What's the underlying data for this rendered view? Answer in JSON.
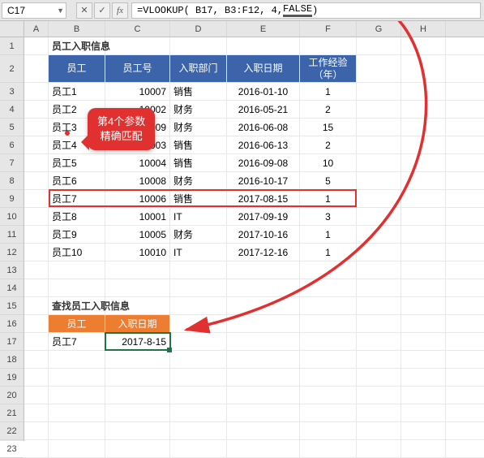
{
  "name_box": "C17",
  "formula": {
    "prefix": "=VLOOKUP( B17, B3:F12, 4, ",
    "false_token": "FALSE",
    "suffix": ")"
  },
  "columns": [
    "A",
    "B",
    "C",
    "D",
    "E",
    "F",
    "G",
    "H"
  ],
  "rows": [
    "1",
    "2",
    "3",
    "4",
    "5",
    "6",
    "7",
    "8",
    "9",
    "10",
    "11",
    "12",
    "13",
    "14",
    "15",
    "16",
    "17",
    "18",
    "19",
    "20",
    "21",
    "22",
    "23"
  ],
  "title1": "员工入职信息",
  "table1": {
    "headers": [
      "员工",
      "员工号",
      "入职部门",
      "入职日期",
      "工作经验（年）"
    ],
    "rows": [
      {
        "emp": "员工1",
        "id": "10007",
        "dept": "销售",
        "date": "2016-01-10",
        "exp": "1"
      },
      {
        "emp": "员工2",
        "id": "10002",
        "dept": "财务",
        "date": "2016-05-21",
        "exp": "2"
      },
      {
        "emp": "员工3",
        "id": "10009",
        "dept": "财务",
        "date": "2016-06-08",
        "exp": "15"
      },
      {
        "emp": "员工4",
        "id": "10003",
        "dept": "销售",
        "date": "2016-06-13",
        "exp": "2"
      },
      {
        "emp": "员工5",
        "id": "10004",
        "dept": "销售",
        "date": "2016-09-08",
        "exp": "10"
      },
      {
        "emp": "员工6",
        "id": "10008",
        "dept": "财务",
        "date": "2016-10-17",
        "exp": "5"
      },
      {
        "emp": "员工7",
        "id": "10006",
        "dept": "销售",
        "date": "2017-08-15",
        "exp": "1"
      },
      {
        "emp": "员工8",
        "id": "10001",
        "dept": "IT",
        "date": "2017-09-19",
        "exp": "3"
      },
      {
        "emp": "员工9",
        "id": "10005",
        "dept": "财务",
        "date": "2017-10-16",
        "exp": "1"
      },
      {
        "emp": "员工10",
        "id": "10010",
        "dept": "IT",
        "date": "2017-12-16",
        "exp": "1"
      }
    ]
  },
  "title2": "查找员工入职信息",
  "table2": {
    "headers": [
      "员工",
      "入职日期"
    ],
    "row": {
      "emp": "员工7",
      "date": "2017-8-15"
    }
  },
  "callout": {
    "line1": "第4个参数",
    "line2": "精确匹配"
  }
}
